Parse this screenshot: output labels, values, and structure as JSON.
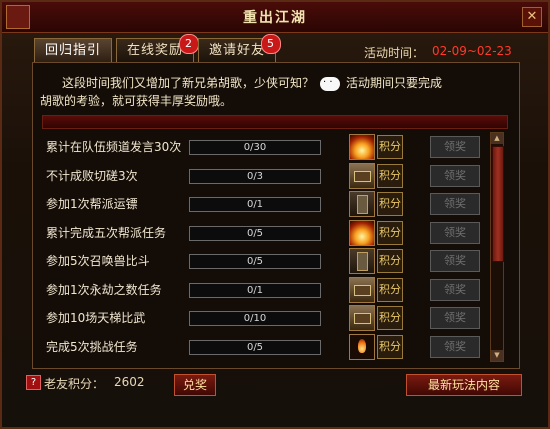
{
  "window": {
    "title": "重出江湖",
    "close": "✕"
  },
  "tabs": [
    {
      "label": "回归指引",
      "badge": ""
    },
    {
      "label": "在线奖励",
      "badge": "2"
    },
    {
      "label": "邀请好友",
      "badge": "5"
    }
  ],
  "activity": {
    "time_label": "活动时间：",
    "time_value": "02-09~02-23"
  },
  "intro": {
    "line1_a": "这段时间我们又增加了新兄弟胡歌，少侠可知？",
    "line1_b": "活动期间只要完成",
    "line2": "胡歌的考验，就可获得丰厚奖励哦。"
  },
  "tasks": [
    {
      "name": "累计在队伍频道发言30次",
      "progress": "0/30",
      "reward_icon": "fire-icon",
      "points": "积分",
      "claim": "领奖"
    },
    {
      "name": "不计成败切磋3次",
      "progress": "0/3",
      "reward_icon": "chest-icon",
      "points": "积分",
      "claim": "领奖"
    },
    {
      "name": "参加1次帮派运镖",
      "progress": "0/1",
      "reward_icon": "book-icon",
      "points": "积分",
      "claim": "领奖"
    },
    {
      "name": "累计完成五次帮派任务",
      "progress": "0/5",
      "reward_icon": "fire-icon",
      "points": "积分",
      "claim": "领奖"
    },
    {
      "name": "参加5次召唤兽比斗",
      "progress": "0/5",
      "reward_icon": "book-icon",
      "points": "积分",
      "claim": "领奖"
    },
    {
      "name": "参加1次永劫之数任务",
      "progress": "0/1",
      "reward_icon": "chest-icon",
      "points": "积分",
      "claim": "领奖"
    },
    {
      "name": "参加10场天梯比武",
      "progress": "0/10",
      "reward_icon": "chest-icon",
      "points": "积分",
      "claim": "领奖"
    },
    {
      "name": "完成5次挑战任务",
      "progress": "0/5",
      "reward_icon": "flame-icon",
      "points": "积分",
      "claim": "领奖"
    }
  ],
  "footer": {
    "help": "?",
    "score_label": "老友积分：",
    "score_value": "2602",
    "redeem": "兑奖",
    "news": "最新玩法内容"
  },
  "scroll": {
    "up": "▲",
    "down": "▼"
  }
}
